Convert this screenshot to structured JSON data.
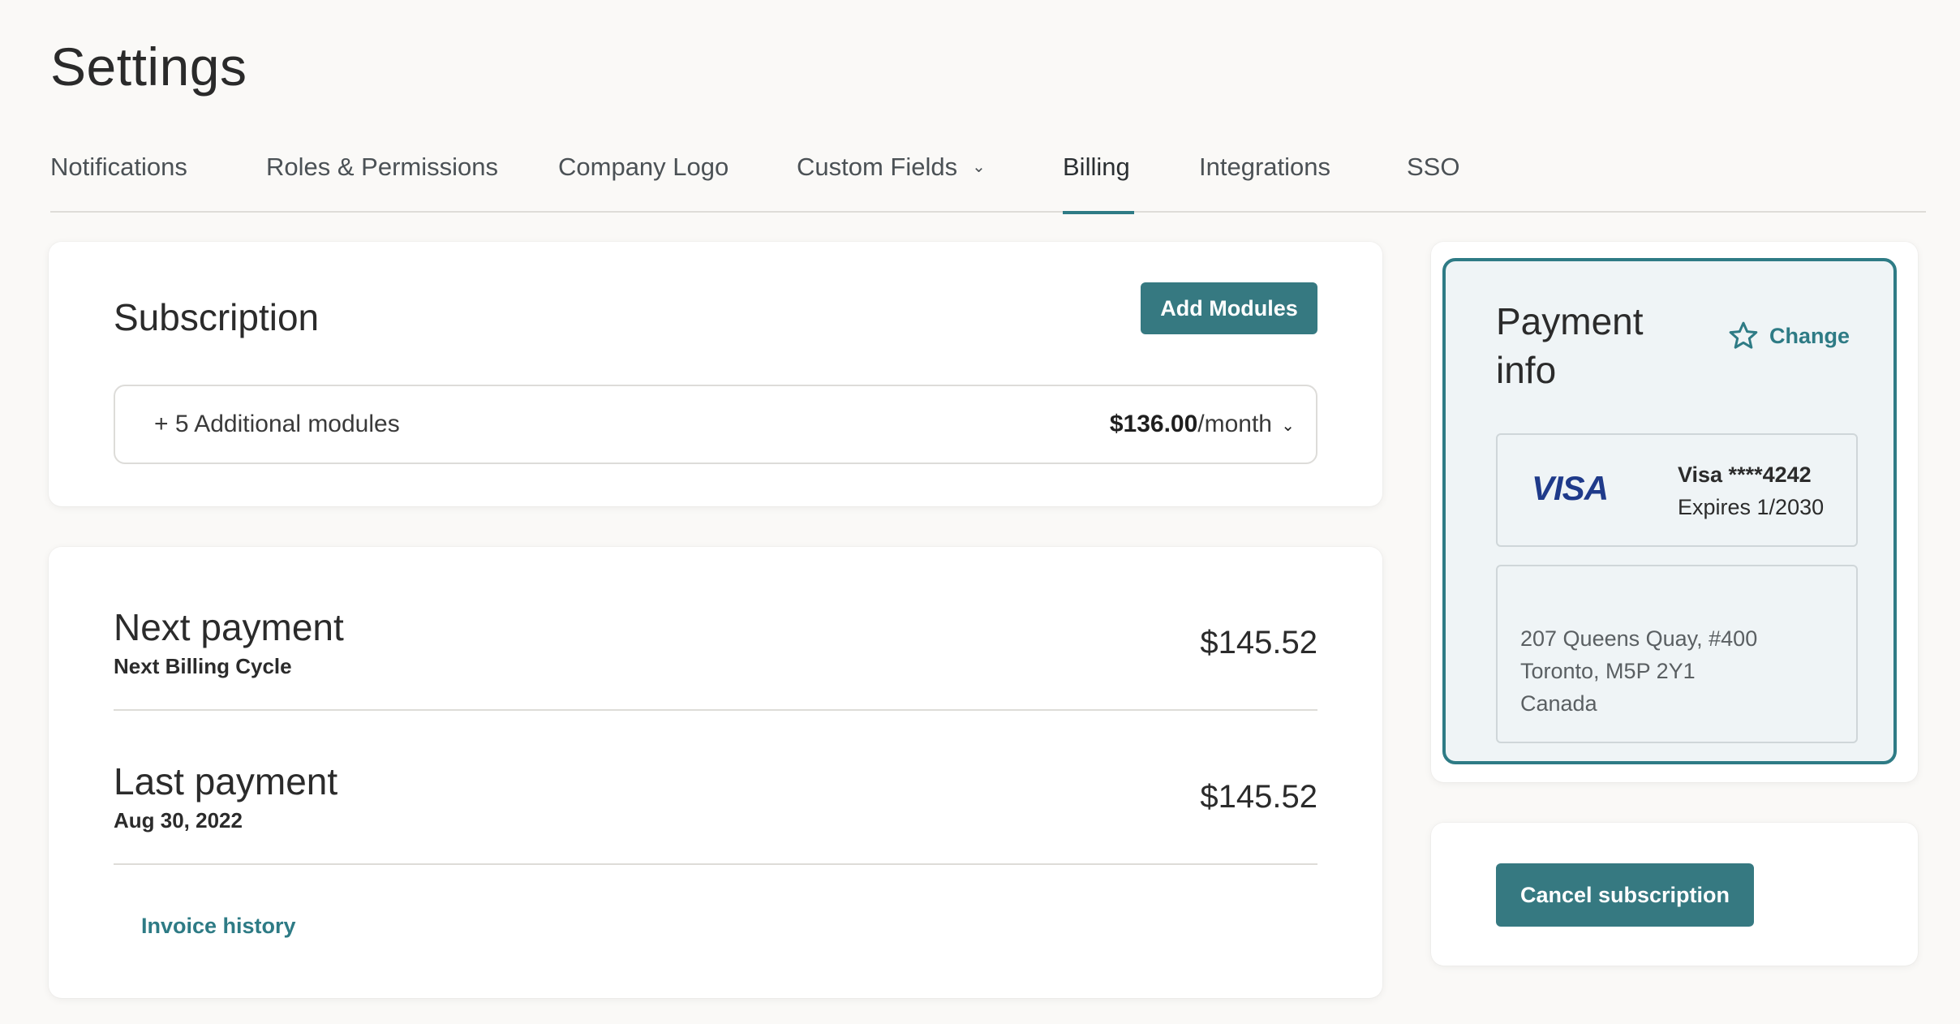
{
  "page": {
    "title": "Settings"
  },
  "tabs": [
    {
      "label": "Notifications"
    },
    {
      "label": "Roles & Permissions"
    },
    {
      "label": "Company Logo"
    },
    {
      "label": "Custom Fields"
    },
    {
      "label": "Billing",
      "active": true
    },
    {
      "label": "Integrations"
    },
    {
      "label": "SSO"
    }
  ],
  "subscription": {
    "title": "Subscription",
    "add_modules_label": "Add Modules",
    "modules_label": "+ 5 Additional modules",
    "price": "$136.00",
    "period": "/month"
  },
  "payments": {
    "next": {
      "title": "Next payment",
      "subtitle": "Next Billing Cycle",
      "amount": "$145.52"
    },
    "last": {
      "title": "Last payment",
      "subtitle": "Aug 30, 2022",
      "amount": "$145.52"
    },
    "invoice_link": "Invoice history"
  },
  "payment_info": {
    "title": "Payment info",
    "change_label": "Change",
    "card_brand": "VISA",
    "card_number": "Visa ****4242",
    "card_expiry": "Expires 1/2030",
    "address": [
      "207 Queens Quay, #400",
      "Toronto, M5P 2Y1",
      "Canada"
    ]
  },
  "cancel": {
    "label": "Cancel subscription"
  },
  "colors": {
    "accent": "#367981",
    "link": "#2e7b85",
    "background": "#faf9f7",
    "card_bg": "#eff4f6"
  },
  "icons": {
    "change": "star-icon",
    "dropdown": "chevron-down-icon"
  }
}
